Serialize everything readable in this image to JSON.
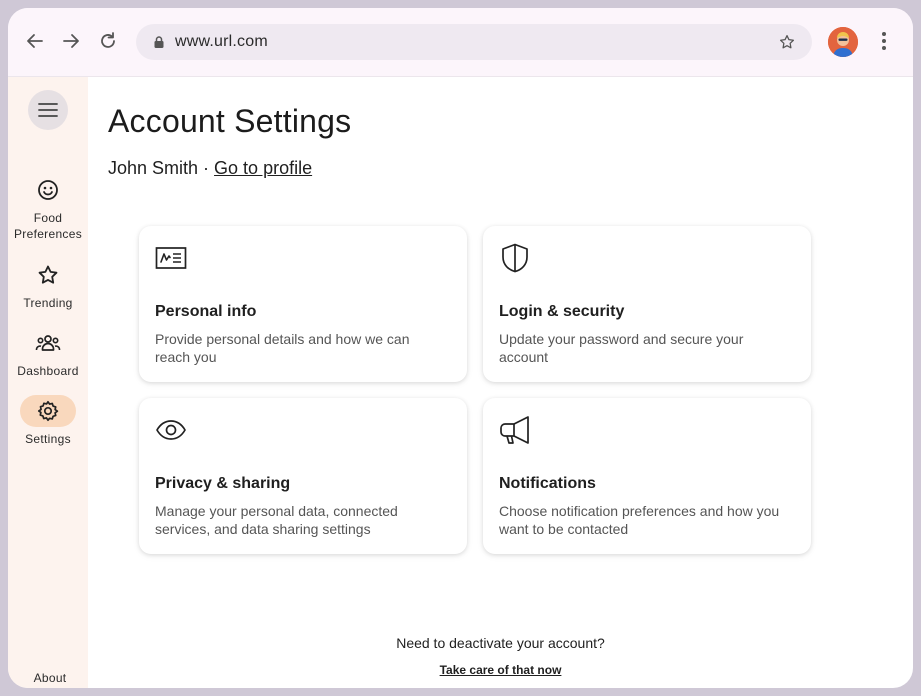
{
  "browser": {
    "url": "www.url.com"
  },
  "rail": {
    "items": [
      {
        "label": "Food\nPreferences",
        "icon": "smiley-icon"
      },
      {
        "label": "Trending",
        "icon": "star-outline-icon"
      },
      {
        "label": "Dashboard",
        "icon": "group-icon"
      },
      {
        "label": "Settings",
        "icon": "gear-icon",
        "active": true
      }
    ],
    "about": "About"
  },
  "page": {
    "title": "Account Settings",
    "user_name": "John Smith",
    "separator": " · ",
    "profile_link": "Go to profile"
  },
  "cards": [
    {
      "title": "Personal info",
      "desc": "Provide personal details and how we can reach you",
      "icon": "id-card-icon"
    },
    {
      "title": "Login & security",
      "desc": "Update your password and secure your account",
      "icon": "shield-icon"
    },
    {
      "title": "Privacy & sharing",
      "desc": "Manage your personal data, connected services, and data sharing settings",
      "icon": "eye-icon"
    },
    {
      "title": "Notifications",
      "desc": "Choose notification preferences and how you want to be contacted",
      "icon": "megaphone-icon"
    }
  ],
  "footer": {
    "question": "Need to deactivate your account?",
    "link": "Take care of that now"
  },
  "colors": {
    "rail_bg": "#fdf3ee",
    "active_pill": "#f9d8bd",
    "chrome_bg": "#fcf5fb"
  }
}
